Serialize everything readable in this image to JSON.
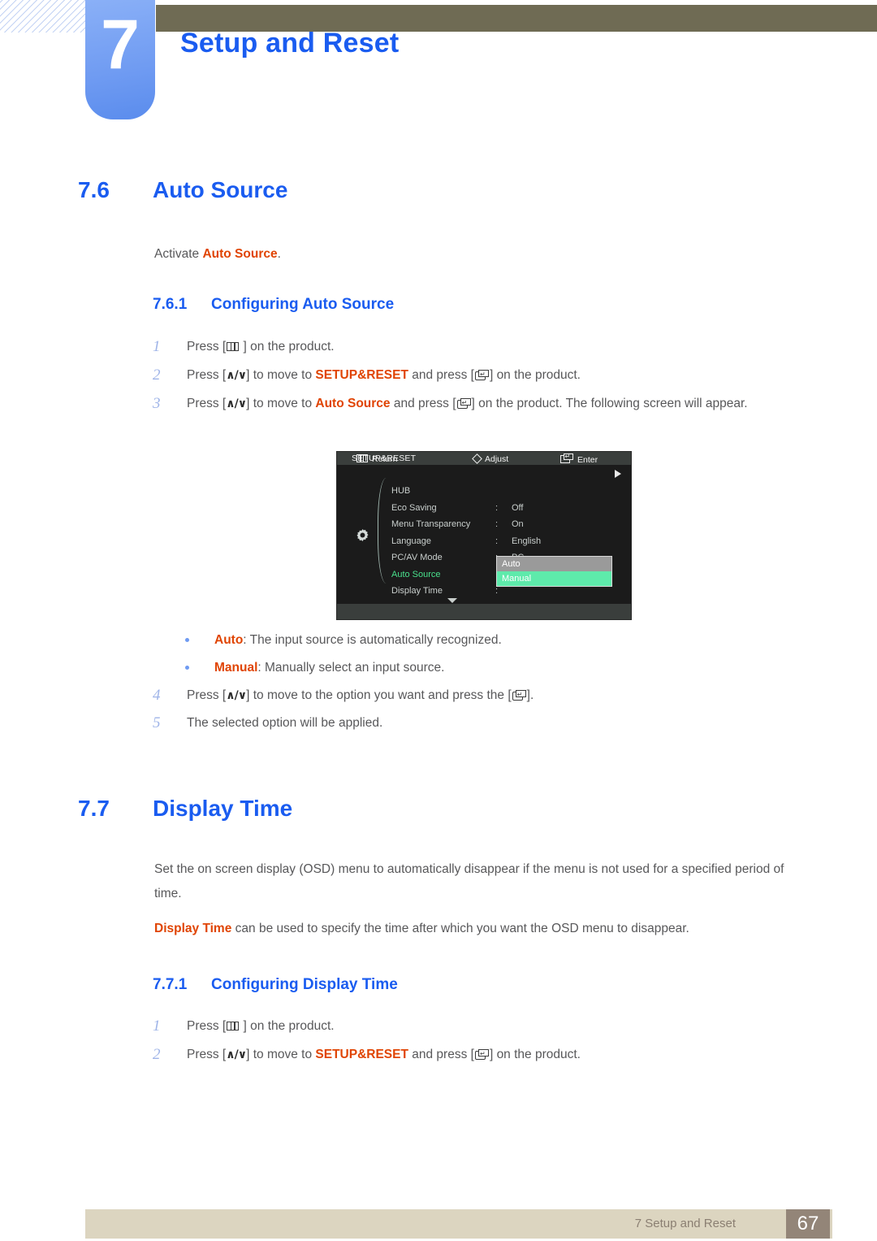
{
  "header": {
    "chapter_number": "7",
    "chapter_title": "Setup and Reset",
    "accent_blue": "#1a5cf0",
    "tab_blue": "#6f9bf2",
    "olive": "#6f6b54"
  },
  "sections": {
    "auto_source": {
      "number": "7.6",
      "title": "Auto Source",
      "intro_prefix": "Activate ",
      "intro_highlight": "Auto Source",
      "intro_suffix": ".",
      "sub": {
        "number": "7.6.1",
        "title": "Configuring Auto Source"
      },
      "steps": [
        {
          "num": "1",
          "parts": [
            {
              "t": "text",
              "v": "Press ["
            },
            {
              "t": "icon",
              "v": "menu-key-icon"
            },
            {
              "t": "text",
              "v": " ] on the product."
            }
          ]
        },
        {
          "num": "2",
          "parts": [
            {
              "t": "text",
              "v": "Press ["
            },
            {
              "t": "icon",
              "v": "up-down-key-icon"
            },
            {
              "t": "text",
              "v": "] to move to "
            },
            {
              "t": "hl",
              "v": "SETUP&RESET"
            },
            {
              "t": "text",
              "v": " and press ["
            },
            {
              "t": "icon",
              "v": "enter-key-icon"
            },
            {
              "t": "text",
              "v": "] on the product."
            }
          ]
        },
        {
          "num": "3",
          "parts": [
            {
              "t": "text",
              "v": "Press ["
            },
            {
              "t": "icon",
              "v": "up-down-key-icon"
            },
            {
              "t": "text",
              "v": "] to move to "
            },
            {
              "t": "hl",
              "v": "Auto Source"
            },
            {
              "t": "text",
              "v": " and press ["
            },
            {
              "t": "icon",
              "v": "enter-key-icon"
            },
            {
              "t": "text",
              "v": "] on the product. The following screen will appear."
            }
          ]
        }
      ],
      "bullets": [
        {
          "term": "Auto",
          "desc": ": The input source is automatically recognized."
        },
        {
          "term": "Manual",
          "desc": ": Manually select an input source."
        }
      ],
      "steps_after": [
        {
          "num": "4",
          "parts": [
            {
              "t": "text",
              "v": "Press ["
            },
            {
              "t": "icon",
              "v": "up-down-key-icon"
            },
            {
              "t": "text",
              "v": "] to move to the option you want and press the ["
            },
            {
              "t": "icon",
              "v": "enter-key-icon"
            },
            {
              "t": "text",
              "v": "]."
            }
          ]
        },
        {
          "num": "5",
          "parts": [
            {
              "t": "text",
              "v": "The selected option will be applied."
            }
          ]
        }
      ]
    },
    "display_time": {
      "number": "7.7",
      "title": "Display Time",
      "paragraph1": "Set the on screen display (OSD) menu to automatically disappear if the menu is not used for a specified period of time.",
      "paragraph2_highlight": "Display Time",
      "paragraph2_rest": " can be used to specify the time after which you want the OSD menu to disappear.",
      "sub": {
        "number": "7.7.1",
        "title": "Configuring Display Time"
      },
      "steps": [
        {
          "num": "1",
          "parts": [
            {
              "t": "text",
              "v": "Press ["
            },
            {
              "t": "icon",
              "v": "menu-key-icon"
            },
            {
              "t": "text",
              "v": " ] on the product."
            }
          ]
        },
        {
          "num": "2",
          "parts": [
            {
              "t": "text",
              "v": "Press ["
            },
            {
              "t": "icon",
              "v": "up-down-key-icon"
            },
            {
              "t": "text",
              "v": "] to move to "
            },
            {
              "t": "hl",
              "v": "SETUP&RESET"
            },
            {
              "t": "text",
              "v": " and press ["
            },
            {
              "t": "icon",
              "v": "enter-key-icon"
            },
            {
              "t": "text",
              "v": "] on the product."
            }
          ]
        }
      ]
    }
  },
  "osd": {
    "title": "SETUP&RESET",
    "rows": [
      {
        "label": "HUB",
        "colon": "",
        "value": "",
        "active": false
      },
      {
        "label": "Eco Saving",
        "colon": ":",
        "value": "Off",
        "active": false
      },
      {
        "label": "Menu Transparency",
        "colon": ":",
        "value": "On",
        "active": false
      },
      {
        "label": "Language",
        "colon": ":",
        "value": "English",
        "active": false
      },
      {
        "label": "PC/AV Mode",
        "colon": ":",
        "value": "PC",
        "active": false
      },
      {
        "label": "Auto Source",
        "colon": ":",
        "value": "",
        "active": true
      },
      {
        "label": "Display Time",
        "colon": ":",
        "value": "",
        "active": false
      }
    ],
    "dropdown": {
      "options": [
        "Auto",
        "Manual"
      ],
      "selected": "Manual",
      "highlight_color": "#5eeaab",
      "bg_color": "#9a9a9a"
    },
    "bottom_bar": [
      {
        "icon": "menu-bars-icon",
        "label": "Return"
      },
      {
        "icon": "diamond-icon",
        "label": "Adjust"
      },
      {
        "icon": "enter-icon",
        "label": "Enter"
      }
    ],
    "active_label_color": "#49e08c"
  },
  "footer": {
    "text": "7 Setup and Reset",
    "page": "67",
    "bar_color": "#dcd5c0",
    "page_color": "#938578"
  }
}
